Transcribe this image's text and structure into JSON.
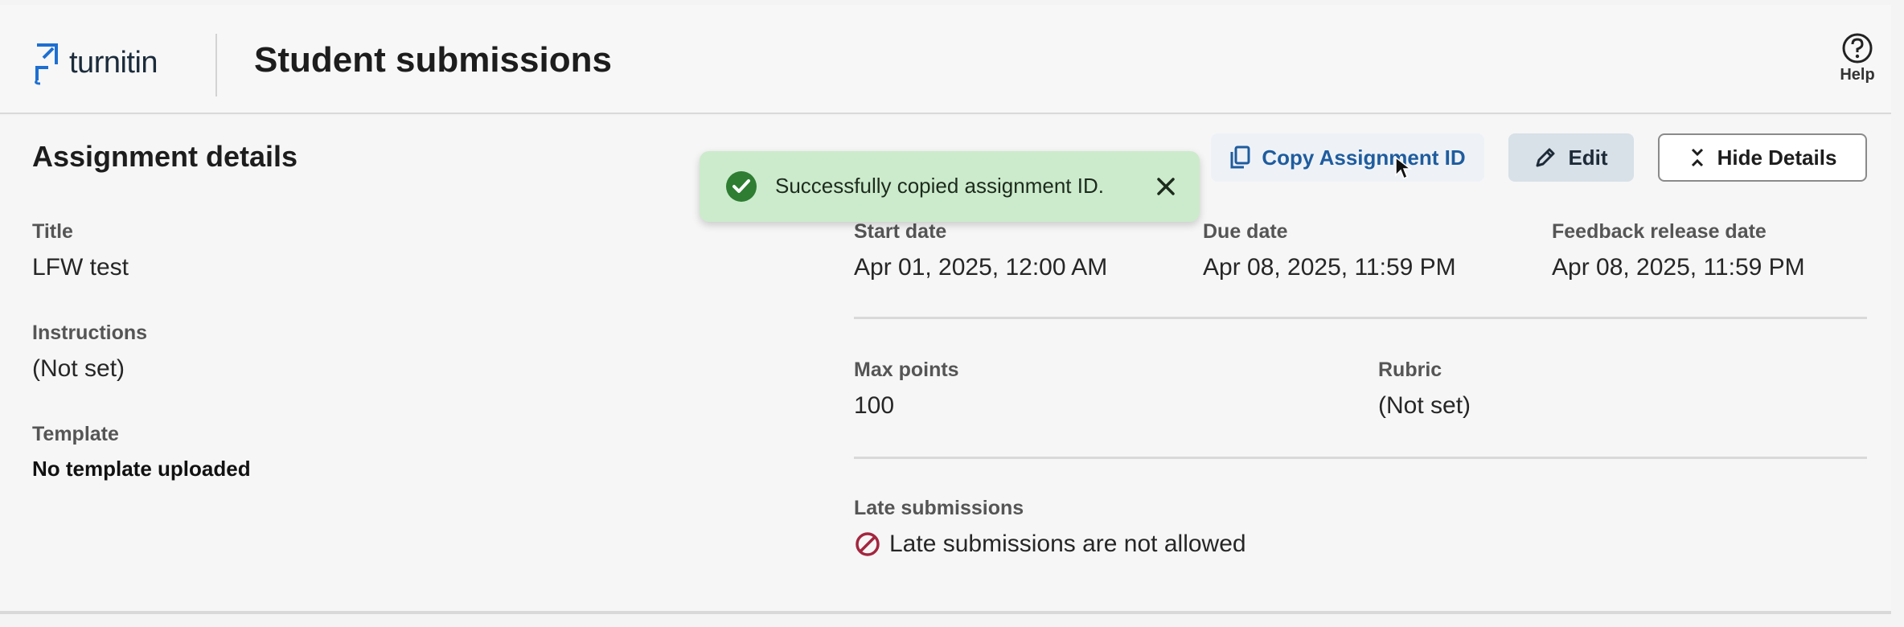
{
  "header": {
    "brand": "turnitin",
    "title": "Student submissions",
    "help_label": "Help"
  },
  "details": {
    "section_title": "Assignment details",
    "buttons": {
      "copy_id": "Copy Assignment ID",
      "edit": "Edit",
      "hide_details": "Hide Details"
    },
    "toast": {
      "message": "Successfully copied assignment ID.",
      "status_color": "#2e7d32"
    },
    "title_label": "Title",
    "title_value": "LFW test",
    "instructions_label": "Instructions",
    "instructions_value": "(Not set)",
    "template_label": "Template",
    "template_value": "No template uploaded",
    "start_date_label": "Start date",
    "start_date_value": "Apr 01, 2025, 12:00 AM",
    "due_date_label": "Due date",
    "due_date_value": "Apr 08, 2025, 11:59 PM",
    "feedback_label": "Feedback release date",
    "feedback_value": "Apr 08, 2025, 11:59 PM",
    "max_points_label": "Max points",
    "max_points_value": "100",
    "rubric_label": "Rubric",
    "rubric_value": "(Not set)",
    "late_label": "Late submissions",
    "late_value": "Late submissions are not allowed",
    "late_icon_color": "#a3263f"
  },
  "colors": {
    "brand_blue": "#1d6fd1",
    "link_blue": "#1f5c9e",
    "toast_bg": "#ccebcc"
  }
}
